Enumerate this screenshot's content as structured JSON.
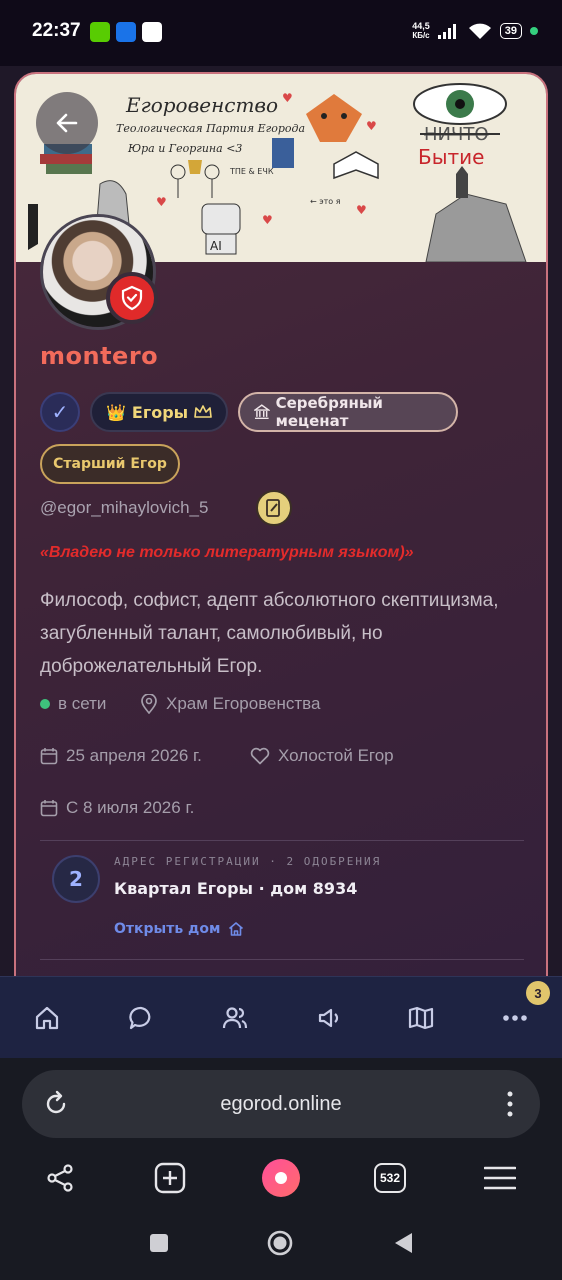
{
  "status_bar": {
    "time": "22:37",
    "net_speed_value": "44,5",
    "net_speed_unit": "КБ/с",
    "battery": "39"
  },
  "profile": {
    "username": "montero",
    "badges": {
      "egory_label": "Егоры",
      "silver_label": "Серебряный меценат",
      "senior_label": "Старший Егор"
    },
    "handle": "@egor_mihaylovich_5",
    "quote": "«Владею не только литературным языком)»",
    "bio": "Философ, софист, адепт абсолютного скептицизма, загубленный талант, самолюбивый, но доброжелательный Егор.",
    "status_online": "в сети",
    "location": "Храм Егоровенства",
    "birthday": "25 апреля 2026 г.",
    "relationship": "Холостой Егор",
    "joined": "С 8 июля 2026 г.",
    "registration": {
      "number": "2",
      "label": "АДРЕС РЕГИСТРАЦИИ · 2 ОДОБРЕНИЯ",
      "address": "Квартал Егоры · дом 8934",
      "open_link": "Открыть дом"
    }
  },
  "banner": {
    "title": "Егоровенство",
    "subtitle": "Теологическая Партия Егорода",
    "line3": "Юра и Георгина <3",
    "strike_text": "НИЧТО",
    "being_text": "Бытие",
    "ai_label": "AI",
    "tpe_label": "ТПЕ & ЕЧК",
    "this_is_me": "← это я"
  },
  "bottom_nav": {
    "more_badge": "3"
  },
  "browser": {
    "url": "egorod.online",
    "tab_count": "532"
  },
  "colors": {
    "card_border": "#c9727e",
    "username": "#f26b5b",
    "quote": "#e32b2b",
    "link": "#6f8be8",
    "nav_bg": "#1e2342"
  }
}
